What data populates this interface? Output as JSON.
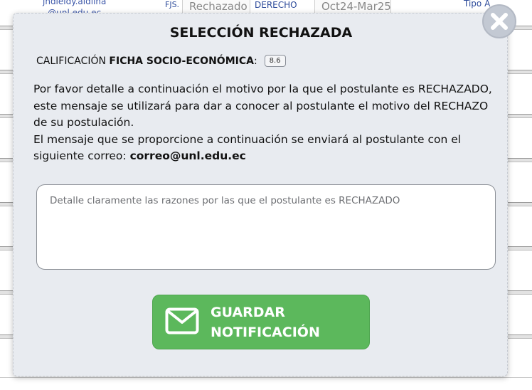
{
  "background": {
    "email_line1": "jhdleidy.aldlina",
    "email_line2": "@unl.edu.ec",
    "fjs": "FJS.",
    "status": "Rechazado",
    "career": "DERECHO",
    "period": "Oct24-Mar25",
    "type": "Tipo A"
  },
  "modal": {
    "title": "SELECCIÓN RECHAZADA",
    "score_prefix": "CALIFICACIÓN",
    "score_label": "FICHA SOCIO-ECONÓMICA",
    "score_colon": ":",
    "score_value": "8.6",
    "message_line1": "Por favor detalle a continuación el motivo por la que el postulante es RECHAZADO,",
    "message_line2": "este mensaje se utilizará para dar a conocer al postulante el motivo del RECHAZO",
    "message_line3": "de su postulación.",
    "message_line4": "El mensaje que se proporcione a continuación se enviará al postulante con el",
    "message_line5_prefix": "siguiente correo:",
    "email": "correo@unl.edu.ec",
    "reason_placeholder": "Detalle claramente las razones por las que el postulante es RECHAZADO",
    "reason_value": "",
    "save_line1": "GUARDAR",
    "save_line2": "NOTIFICACIÓN"
  },
  "icons": {
    "close": "close-icon",
    "mail": "mail-icon"
  },
  "colors": {
    "modal_bg": "#e8ebf0",
    "save_button": "#5cb85c",
    "close_button": "#c3c9d3"
  }
}
